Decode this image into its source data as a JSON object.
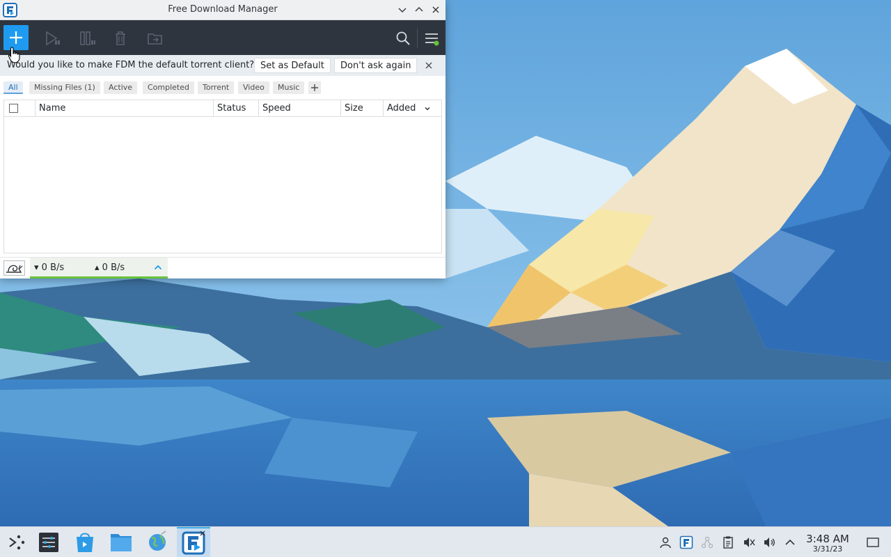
{
  "window": {
    "title": "Free Download Manager"
  },
  "toolbar": {
    "icons": [
      "add-icon",
      "resume-icon",
      "pause-icon",
      "delete-icon",
      "move-folder-icon",
      "search-icon",
      "menu-icon"
    ]
  },
  "notice": {
    "message": "Would you like to make FDM the default torrent client?",
    "set_default": "Set as Default",
    "dont_ask": "Don't ask again"
  },
  "filters": {
    "all": "All",
    "missing": "Missing Files (1)",
    "active": "Active",
    "completed": "Completed",
    "torrent": "Torrent",
    "video": "Video",
    "music": "Music"
  },
  "table": {
    "columns": {
      "name": "Name",
      "status": "Status",
      "speed": "Speed",
      "size": "Size",
      "added": "Added"
    },
    "rows": []
  },
  "statusbar": {
    "download": "0 B/s",
    "upload": "0 B/s"
  },
  "taskbar": {
    "time": "3:48 AM",
    "date": "3/31/23"
  },
  "colors": {
    "accent": "#1e9bf0",
    "toolbar_bg": "#2f353f",
    "speed_bar": "#67c23a"
  }
}
